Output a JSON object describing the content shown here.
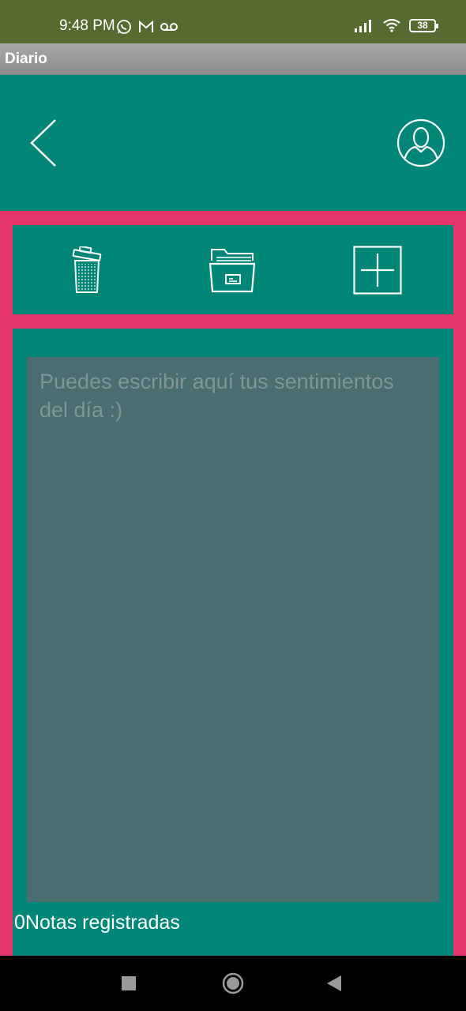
{
  "status_bar": {
    "time": "9:48 PM",
    "battery_level": "38",
    "left_icons": [
      "whatsapp-icon",
      "gmail-icon",
      "voicemail-icon"
    ],
    "right_icons": [
      "signal-icon",
      "wifi-icon",
      "battery-icon"
    ]
  },
  "app": {
    "title": "Diario"
  },
  "header": {
    "back_icon": "chevron-left-icon",
    "profile_icon": "user-profile-icon"
  },
  "toolbar": {
    "items": [
      "trash-icon",
      "folder-icon",
      "add-icon"
    ]
  },
  "editor": {
    "value": "",
    "placeholder": "Puedes escribir aquí tus sentimientos del día :)",
    "notes_count": "0Notas registradas"
  },
  "nav_bar": {
    "items": [
      "recents-square-icon",
      "home-circle-icon",
      "back-triangle-icon"
    ]
  },
  "colors": {
    "status_bar": "#556b2f",
    "teal": "#008677",
    "pink_border": "#e8356c",
    "text_area": "#4a6e70"
  }
}
